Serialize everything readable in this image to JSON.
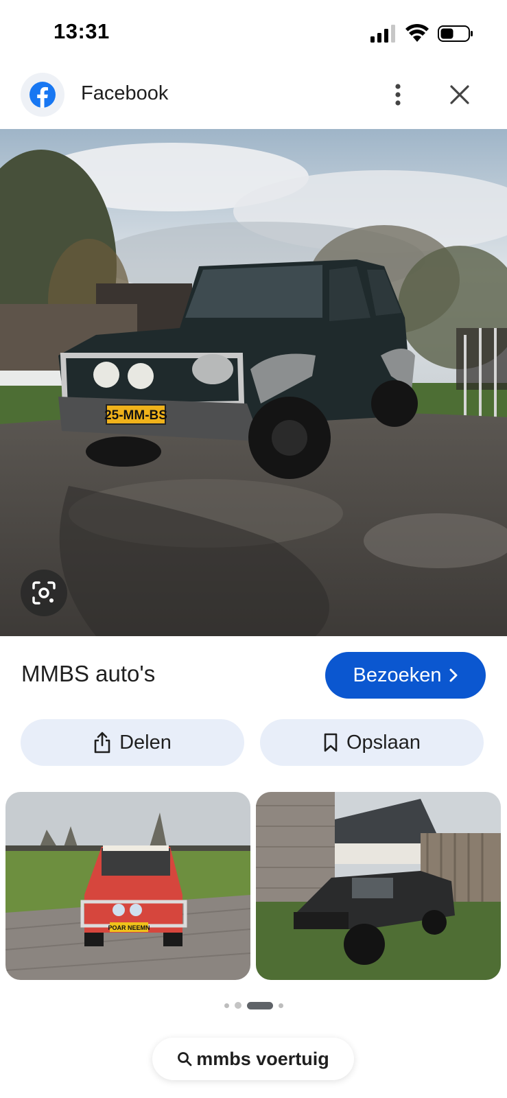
{
  "status_bar": {
    "time": "13:31"
  },
  "header": {
    "source_name": "Facebook",
    "icons": [
      "facebook-logo-icon",
      "more-vert-icon",
      "close-icon"
    ]
  },
  "main_image": {
    "plate_text": "25-MM-BS"
  },
  "result": {
    "title": "MMBS auto's",
    "visit_label": "Bezoeken"
  },
  "actions": {
    "share_label": "Delen",
    "save_label": "Opslaan"
  },
  "related": [
    {
      "plate_text": "POAR NEEMN"
    },
    {
      "plate_text": ""
    }
  ],
  "pager": {
    "count": 4,
    "active_index": 2
  },
  "search": {
    "query": "mmbs voertuig"
  },
  "colors": {
    "accent": "#0b57d0",
    "chip_background": "#e8eef9",
    "facebook_blue": "#1877f2"
  }
}
